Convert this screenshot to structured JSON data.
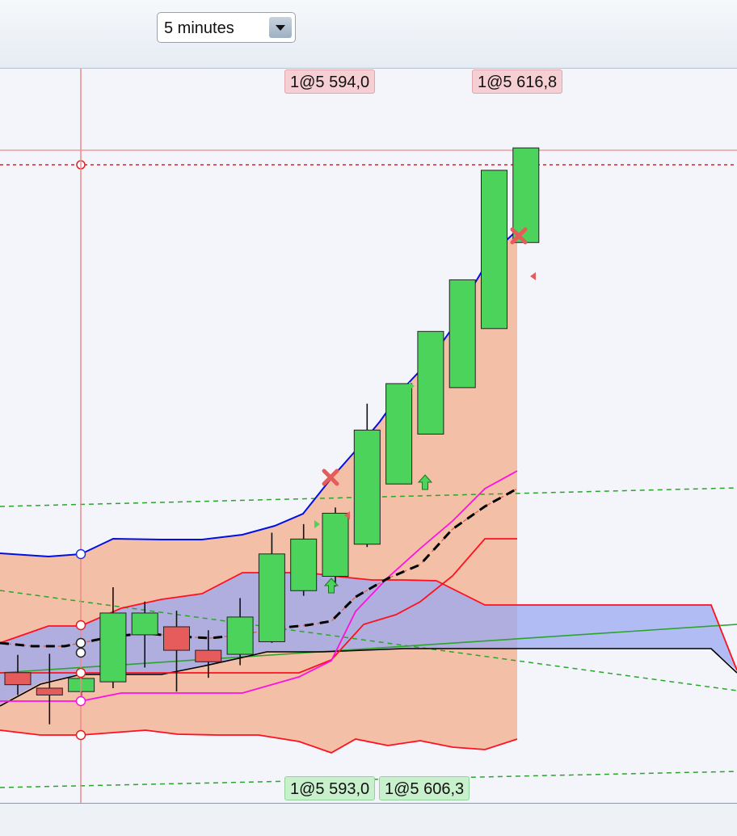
{
  "toolbar": {
    "timeframe_value": "5 minutes"
  },
  "orders": {
    "sell": [
      "1@5 594,0",
      "1@5 616,8"
    ],
    "buy": [
      "1@5 593,0",
      "1@5 606,3"
    ]
  },
  "colors": {
    "up_candle": "#4cd35c",
    "down_candle": "#e65b5b",
    "upper_band": "#0010e0",
    "lower_band": "#ff1020",
    "moving_average": "#000000",
    "magenta_line": "#ff10e0",
    "envelope_fill": "#f4b090",
    "cloud_fill": "#9aa8f0",
    "trend_line": "#2aa52a"
  },
  "chart_data": {
    "type": "candlestick",
    "candles": [
      {
        "o": 5588.2,
        "h": 5591.3,
        "l": 5584.3,
        "c": 5586.1
      },
      {
        "o": 5585.5,
        "h": 5591.5,
        "l": 5579.2,
        "c": 5584.3
      },
      {
        "o": 5584.9,
        "h": 5589.0,
        "l": 5584.0,
        "c": 5587.2
      },
      {
        "o": 5586.6,
        "h": 5603.1,
        "l": 5585.5,
        "c": 5598.6
      },
      {
        "o": 5594.8,
        "h": 5600.6,
        "l": 5589.1,
        "c": 5598.6
      },
      {
        "o": 5596.2,
        "h": 5599.0,
        "l": 5584.9,
        "c": 5592.1
      },
      {
        "o": 5592.1,
        "h": 5595.6,
        "l": 5587.3,
        "c": 5590.1
      },
      {
        "o": 5591.4,
        "h": 5601.2,
        "l": 5589.5,
        "c": 5597.9
      },
      {
        "o": 5593.6,
        "h": 5612.6,
        "l": 5593.4,
        "c": 5608.9
      },
      {
        "o": 5602.5,
        "h": 5614.1,
        "l": 5601.6,
        "c": 5611.5
      },
      {
        "o": 5605.0,
        "h": 5617.0,
        "l": 5603.2,
        "c": 5616.0
      },
      {
        "o": 5610.6,
        "h": 5635.1,
        "l": 5610.1,
        "c": 5630.5
      },
      {
        "o": 5621.1,
        "h": 5638.2,
        "l": 5621.1,
        "c": 5638.6
      },
      {
        "o": 5629.8,
        "h": 5647.7,
        "l": 5629.8,
        "c": 5647.7
      },
      {
        "o": 5637.9,
        "h": 5654.6,
        "l": 5637.9,
        "c": 5656.7
      },
      {
        "o": 5648.2,
        "h": 5672.0,
        "l": 5648.2,
        "c": 5675.8
      },
      {
        "o": 5663.2,
        "h": 5670.8,
        "l": 5663.2,
        "c": 5679.7
      }
    ]
  }
}
